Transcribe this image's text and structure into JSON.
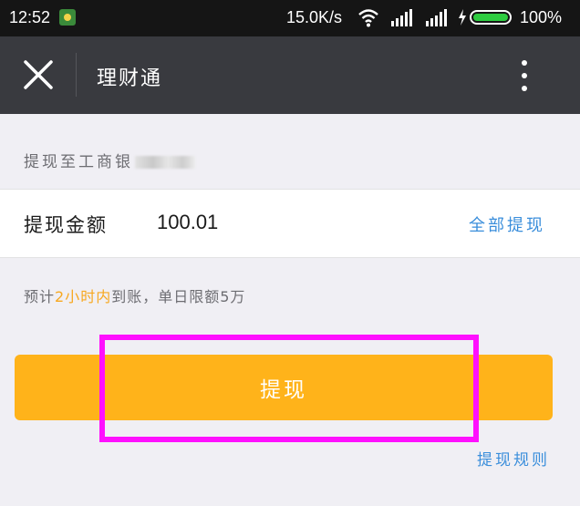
{
  "status_bar": {
    "time": "12:52",
    "network_speed": "15.0K/s",
    "battery": "100%",
    "icons": [
      "app-notification-icon",
      "wifi-icon",
      "signal-icon",
      "signal-icon",
      "charging-icon",
      "battery-icon"
    ]
  },
  "header": {
    "title": "理财通",
    "close_icon": "close-icon",
    "more_icon": "more-vertical-icon"
  },
  "destination": {
    "label": "提现至工商银",
    "account_masked": true
  },
  "amount": {
    "label": "提现金额",
    "value": "100.01",
    "withdraw_all": "全部提现"
  },
  "note": {
    "prefix": "预计",
    "highlight": "2小时内",
    "suffix": "到账，单日限额5万"
  },
  "actions": {
    "withdraw_label": "提现",
    "rules_link": "提现规则"
  },
  "colors": {
    "header_bg": "#393a3f",
    "status_bg": "#151515",
    "primary_button": "#ffb31a",
    "link": "#3a8edb",
    "note_highlight": "#f7a820",
    "annotation_box": "#ff10ff"
  }
}
